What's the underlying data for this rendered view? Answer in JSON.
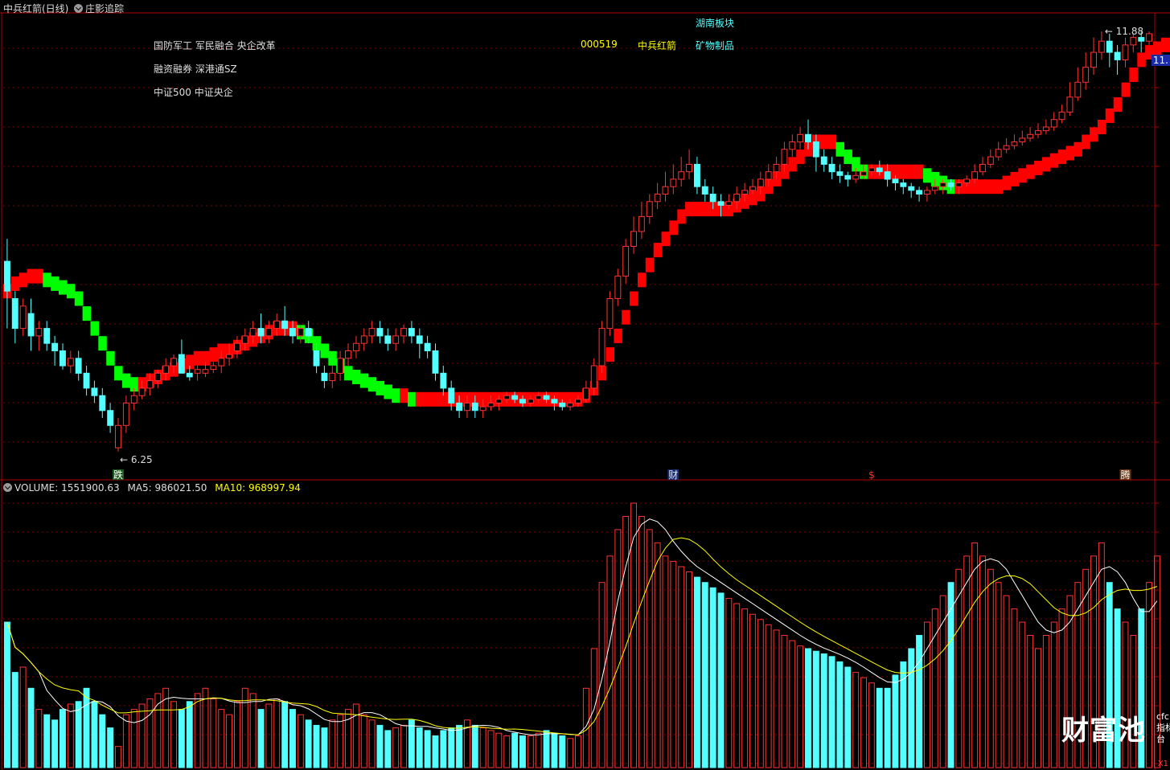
{
  "title_bar": {
    "stock_title": "中兵红箭(日线)",
    "indicator_name": "庄影追踪"
  },
  "info": {
    "line1": "国防军工 军民融合 央企改革",
    "line2": "融资融券 深港通SZ",
    "line3": "中证500 中证央企",
    "code": "000519",
    "name": "中兵红箭",
    "sector": "矿物制品",
    "region": "湖南板块"
  },
  "price_axis_tag": "11.",
  "volume_header": {
    "volume": "VOLUME: 1551900.63",
    "ma5": "MA5: 986021.50",
    "ma10": "MA10: 968997.94"
  },
  "events": [
    {
      "label": "跌",
      "color": "#ffffff",
      "bg": "#1d5a1d",
      "index": 14
    },
    {
      "label": "财",
      "color": "#dfe8ff",
      "bg": "#1a2c6e",
      "index": 84
    },
    {
      "label": "$",
      "color": "#ff3030",
      "bg": "",
      "index": 109
    },
    {
      "label": "腾",
      "color": "#ffffff",
      "bg": "#6a3412",
      "index": 141
    }
  ],
  "watermark": {
    "brand": "财富池",
    "domain": "cfcpn.com",
    "slogan": "指标交易平台"
  },
  "zoom_label": "X1",
  "colors": {
    "up": "#ff3232",
    "down": "#54ffff",
    "band_up": "#ff0000",
    "band_down": "#00ff00",
    "ma5": "#ffffff",
    "ma10": "#ffff00",
    "grid": "#7a0000"
  },
  "chart_data": {
    "type": "candlestick",
    "price_labels": {
      "high": "11.88",
      "low": "6.25"
    },
    "candles": [
      [
        8.8,
        8.4,
        9.1,
        7.9
      ],
      [
        8.3,
        7.9,
        8.4,
        7.7
      ],
      [
        7.9,
        8.2,
        8.3,
        7.8
      ],
      [
        8.1,
        7.8,
        8.3,
        7.6
      ],
      [
        7.8,
        7.9,
        8.0,
        7.6
      ],
      [
        7.9,
        7.7,
        8.0,
        7.6
      ],
      [
        7.7,
        7.6,
        7.8,
        7.4
      ],
      [
        7.6,
        7.4,
        7.7,
        7.35
      ],
      [
        7.4,
        7.5,
        7.6,
        7.3
      ],
      [
        7.5,
        7.3,
        7.6,
        7.2
      ],
      [
        7.3,
        7.1,
        7.4,
        7.0
      ],
      [
        7.1,
        7.0,
        7.2,
        6.9
      ],
      [
        7.0,
        6.8,
        7.1,
        6.7
      ],
      [
        6.8,
        6.6,
        6.9,
        6.5
      ],
      [
        6.3,
        6.6,
        6.7,
        6.25
      ],
      [
        6.6,
        6.9,
        7.0,
        6.5
      ],
      [
        6.9,
        7.0,
        7.1,
        6.8
      ],
      [
        7.0,
        7.1,
        7.2,
        6.95
      ],
      [
        7.1,
        7.2,
        7.3,
        7.0
      ],
      [
        7.2,
        7.3,
        7.35,
        7.1
      ],
      [
        7.3,
        7.4,
        7.5,
        7.2
      ],
      [
        7.4,
        7.5,
        7.55,
        7.3
      ],
      [
        7.55,
        7.3,
        7.75,
        7.3
      ],
      [
        7.3,
        7.25,
        7.4,
        7.2
      ],
      [
        7.3,
        7.35,
        7.4,
        7.2
      ],
      [
        7.3,
        7.35,
        7.45,
        7.25
      ],
      [
        7.35,
        7.4,
        7.45,
        7.3
      ],
      [
        7.4,
        7.5,
        7.6,
        7.3
      ],
      [
        7.5,
        7.55,
        7.7,
        7.4
      ],
      [
        7.6,
        7.7,
        7.8,
        7.5
      ],
      [
        7.7,
        7.8,
        7.9,
        7.6
      ],
      [
        7.8,
        7.9,
        8.0,
        7.7
      ],
      [
        7.9,
        7.8,
        8.1,
        7.7
      ],
      [
        7.8,
        7.9,
        8.0,
        7.7
      ],
      [
        7.9,
        8.0,
        8.1,
        7.8
      ],
      [
        8.0,
        7.9,
        8.2,
        7.8
      ],
      [
        7.9,
        7.8,
        8.0,
        7.7
      ],
      [
        7.8,
        7.9,
        7.95,
        7.7
      ],
      [
        7.9,
        7.8,
        8.0,
        7.7
      ],
      [
        7.6,
        7.4,
        7.7,
        7.3
      ],
      [
        7.3,
        7.2,
        7.4,
        7.1
      ],
      [
        7.2,
        7.3,
        7.4,
        7.1
      ],
      [
        7.3,
        7.5,
        7.6,
        7.2
      ],
      [
        7.5,
        7.6,
        7.7,
        7.4
      ],
      [
        7.6,
        7.7,
        7.8,
        7.5
      ],
      [
        7.7,
        7.8,
        7.9,
        7.6
      ],
      [
        7.8,
        7.9,
        8.0,
        7.7
      ],
      [
        7.9,
        7.8,
        8.0,
        7.7
      ],
      [
        7.8,
        7.7,
        7.9,
        7.6
      ],
      [
        7.7,
        7.8,
        7.9,
        7.6
      ],
      [
        7.8,
        7.9,
        7.95,
        7.7
      ],
      [
        7.9,
        7.8,
        8.0,
        7.7
      ],
      [
        7.8,
        7.7,
        7.9,
        7.5
      ],
      [
        7.7,
        7.6,
        7.8,
        7.5
      ],
      [
        7.6,
        7.3,
        7.7,
        7.2
      ],
      [
        7.3,
        7.1,
        7.4,
        7.0
      ],
      [
        7.1,
        6.9,
        7.2,
        6.8
      ],
      [
        6.9,
        6.8,
        7.0,
        6.7
      ],
      [
        6.8,
        6.9,
        7.0,
        6.7
      ],
      [
        6.9,
        6.8,
        7.0,
        6.7
      ],
      [
        6.8,
        6.85,
        6.95,
        6.7
      ],
      [
        6.85,
        6.9,
        7.0,
        6.8
      ],
      [
        6.9,
        6.95,
        7.0,
        6.8
      ],
      [
        6.95,
        7.0,
        7.05,
        6.9
      ],
      [
        7.0,
        6.95,
        7.05,
        6.9
      ],
      [
        6.95,
        6.9,
        7.0,
        6.85
      ],
      [
        6.9,
        6.95,
        7.0,
        6.85
      ],
      [
        6.95,
        7.0,
        7.05,
        6.9
      ],
      [
        7.0,
        6.95,
        7.05,
        6.9
      ],
      [
        6.95,
        6.9,
        7.0,
        6.8
      ],
      [
        6.9,
        6.85,
        6.95,
        6.8
      ],
      [
        6.85,
        6.9,
        6.95,
        6.8
      ],
      [
        6.9,
        6.95,
        7.0,
        6.85
      ],
      [
        6.95,
        7.1,
        7.2,
        6.9
      ],
      [
        7.1,
        7.4,
        7.5,
        7.0
      ],
      [
        7.4,
        7.9,
        8.0,
        7.3
      ],
      [
        7.9,
        8.3,
        8.4,
        7.8
      ],
      [
        8.3,
        8.6,
        8.7,
        8.2
      ],
      [
        8.6,
        9.0,
        9.1,
        8.5
      ],
      [
        9.0,
        9.2,
        9.4,
        8.9
      ],
      [
        9.2,
        9.4,
        9.6,
        9.1
      ],
      [
        9.4,
        9.6,
        9.7,
        9.3
      ],
      [
        9.6,
        9.7,
        9.85,
        9.5
      ],
      [
        9.7,
        9.8,
        10.0,
        9.6
      ],
      [
        9.8,
        9.9,
        10.1,
        9.7
      ],
      [
        9.9,
        10.0,
        10.2,
        9.8
      ],
      [
        10.0,
        10.1,
        10.3,
        9.9
      ],
      [
        10.1,
        9.8,
        10.2,
        9.7
      ],
      [
        9.8,
        9.7,
        9.9,
        9.6
      ],
      [
        9.7,
        9.6,
        9.8,
        9.5
      ],
      [
        9.6,
        9.55,
        9.7,
        9.4
      ],
      [
        9.55,
        9.6,
        9.7,
        9.5
      ],
      [
        9.6,
        9.7,
        9.8,
        9.5
      ],
      [
        9.7,
        9.75,
        9.85,
        9.6
      ],
      [
        9.75,
        9.8,
        9.9,
        9.7
      ],
      [
        9.8,
        9.9,
        10.0,
        9.7
      ],
      [
        9.9,
        10.0,
        10.1,
        9.8
      ],
      [
        10.0,
        10.1,
        10.2,
        9.9
      ],
      [
        10.1,
        10.3,
        10.4,
        10.0
      ],
      [
        10.3,
        10.4,
        10.5,
        10.2
      ],
      [
        10.4,
        10.5,
        10.6,
        10.3
      ],
      [
        10.5,
        10.4,
        10.7,
        10.3
      ],
      [
        10.4,
        10.2,
        10.5,
        10.0
      ],
      [
        10.2,
        10.1,
        10.3,
        10.0
      ],
      [
        10.1,
        10.0,
        10.2,
        9.9
      ],
      [
        10.0,
        9.95,
        10.1,
        9.85
      ],
      [
        9.95,
        9.9,
        10.0,
        9.8
      ],
      [
        9.9,
        9.95,
        10.05,
        9.85
      ],
      [
        9.95,
        10.0,
        10.1,
        9.9
      ],
      [
        10.0,
        10.05,
        10.1,
        9.95
      ],
      [
        10.05,
        10.0,
        10.15,
        9.95
      ],
      [
        10.0,
        9.9,
        10.1,
        9.8
      ],
      [
        9.9,
        9.85,
        9.95,
        9.75
      ],
      [
        9.85,
        9.8,
        9.9,
        9.7
      ],
      [
        9.8,
        9.75,
        9.85,
        9.65
      ],
      [
        9.75,
        9.7,
        9.8,
        9.6
      ],
      [
        9.7,
        9.75,
        9.8,
        9.6
      ],
      [
        9.75,
        9.8,
        9.9,
        9.7
      ],
      [
        9.8,
        9.85,
        9.9,
        9.7
      ],
      [
        9.85,
        9.8,
        9.9,
        9.75
      ],
      [
        9.8,
        9.85,
        9.9,
        9.7
      ],
      [
        9.85,
        9.9,
        9.95,
        9.8
      ],
      [
        9.9,
        10.0,
        10.1,
        9.85
      ],
      [
        10.0,
        10.1,
        10.2,
        9.95
      ],
      [
        10.1,
        10.2,
        10.3,
        10.05
      ],
      [
        10.2,
        10.3,
        10.4,
        10.15
      ],
      [
        10.3,
        10.35,
        10.45,
        10.25
      ],
      [
        10.35,
        10.4,
        10.5,
        10.3
      ],
      [
        10.4,
        10.45,
        10.55,
        10.35
      ],
      [
        10.45,
        10.5,
        10.6,
        10.4
      ],
      [
        10.5,
        10.55,
        10.65,
        10.45
      ],
      [
        10.55,
        10.6,
        10.7,
        10.5
      ],
      [
        10.6,
        10.7,
        10.8,
        10.55
      ],
      [
        10.7,
        10.8,
        10.9,
        10.65
      ],
      [
        10.8,
        11.0,
        11.2,
        10.75
      ],
      [
        11.0,
        11.2,
        11.4,
        10.95
      ],
      [
        11.2,
        11.4,
        11.6,
        11.1
      ],
      [
        11.4,
        11.6,
        11.8,
        11.3
      ],
      [
        11.6,
        11.75,
        11.88,
        11.5
      ],
      [
        11.75,
        11.6,
        11.85,
        11.4
      ],
      [
        11.6,
        11.5,
        11.7,
        11.3
      ],
      [
        11.5,
        11.7,
        11.8,
        11.4
      ],
      [
        11.7,
        11.8,
        11.85,
        11.6
      ],
      [
        11.8,
        11.75,
        11.88,
        11.6
      ],
      [
        11.75,
        11.85,
        11.88,
        11.7
      ]
    ],
    "trend_band": [
      8.4,
      8.5,
      8.55,
      8.6,
      8.6,
      8.55,
      8.5,
      8.45,
      8.4,
      8.3,
      8.1,
      7.9,
      7.7,
      7.5,
      7.3,
      7.2,
      7.15,
      7.15,
      7.2,
      7.25,
      7.3,
      7.35,
      7.4,
      7.45,
      7.5,
      7.5,
      7.55,
      7.6,
      7.6,
      7.65,
      7.7,
      7.75,
      7.8,
      7.85,
      7.9,
      7.9,
      7.9,
      7.85,
      7.8,
      7.7,
      7.6,
      7.5,
      7.4,
      7.3,
      7.25,
      7.2,
      7.15,
      7.1,
      7.05,
      7.0,
      7.0,
      6.95,
      6.95,
      6.95,
      6.95,
      6.95,
      6.95,
      6.95,
      6.95,
      6.95,
      6.95,
      6.95,
      6.95,
      6.95,
      6.95,
      6.95,
      6.95,
      6.95,
      6.95,
      6.95,
      6.95,
      6.95,
      6.95,
      7.0,
      7.1,
      7.3,
      7.55,
      7.8,
      8.05,
      8.3,
      8.55,
      8.75,
      8.95,
      9.1,
      9.25,
      9.4,
      9.5,
      9.5,
      9.5,
      9.5,
      9.5,
      9.5,
      9.55,
      9.6,
      9.65,
      9.7,
      9.8,
      9.9,
      10.0,
      10.1,
      10.2,
      10.3,
      10.4,
      10.4,
      10.4,
      10.3,
      10.2,
      10.1,
      10.0,
      10.0,
      10.0,
      10.0,
      10.0,
      10.0,
      10.0,
      10.0,
      9.95,
      9.9,
      9.85,
      9.8,
      9.8,
      9.8,
      9.8,
      9.8,
      9.8,
      9.8,
      9.85,
      9.9,
      9.95,
      10.0,
      10.05,
      10.1,
      10.15,
      10.2,
      10.25,
      10.3,
      10.4,
      10.5,
      10.6,
      10.75,
      10.9,
      11.1,
      11.3,
      11.5,
      11.6,
      11.65,
      11.7,
      11.7,
      11.7,
      11.7,
      11.75,
      11.8,
      11.85
    ],
    "volume": [
      55,
      36,
      38,
      30,
      22,
      20,
      18,
      22,
      24,
      25,
      30,
      25,
      20,
      15,
      8,
      20,
      22,
      24,
      26,
      28,
      30,
      25,
      22,
      25,
      28,
      30,
      26,
      22,
      20,
      25,
      30,
      28,
      22,
      24,
      26,
      25,
      22,
      20,
      18,
      16,
      15,
      18,
      20,
      22,
      24,
      20,
      18,
      16,
      14,
      15,
      16,
      18,
      15,
      14,
      12,
      14,
      15,
      16,
      18,
      16,
      15,
      14,
      13,
      12,
      13,
      12,
      12,
      13,
      14,
      13,
      12,
      11,
      12,
      30,
      45,
      70,
      80,
      90,
      95,
      100,
      95,
      90,
      85,
      80,
      78,
      76,
      74,
      72,
      70,
      68,
      66,
      64,
      62,
      60,
      58,
      56,
      54,
      52,
      50,
      48,
      46,
      45,
      44,
      43,
      42,
      40,
      38,
      36,
      34,
      32,
      30,
      30,
      35,
      40,
      45,
      50,
      55,
      60,
      65,
      70,
      75,
      80,
      85,
      80,
      75,
      70,
      65,
      60,
      55,
      50,
      45,
      50,
      55,
      60,
      65,
      70,
      75,
      80,
      85,
      70,
      60,
      55,
      50,
      60,
      70,
      80
    ],
    "ma5": [],
    "ma10": []
  }
}
